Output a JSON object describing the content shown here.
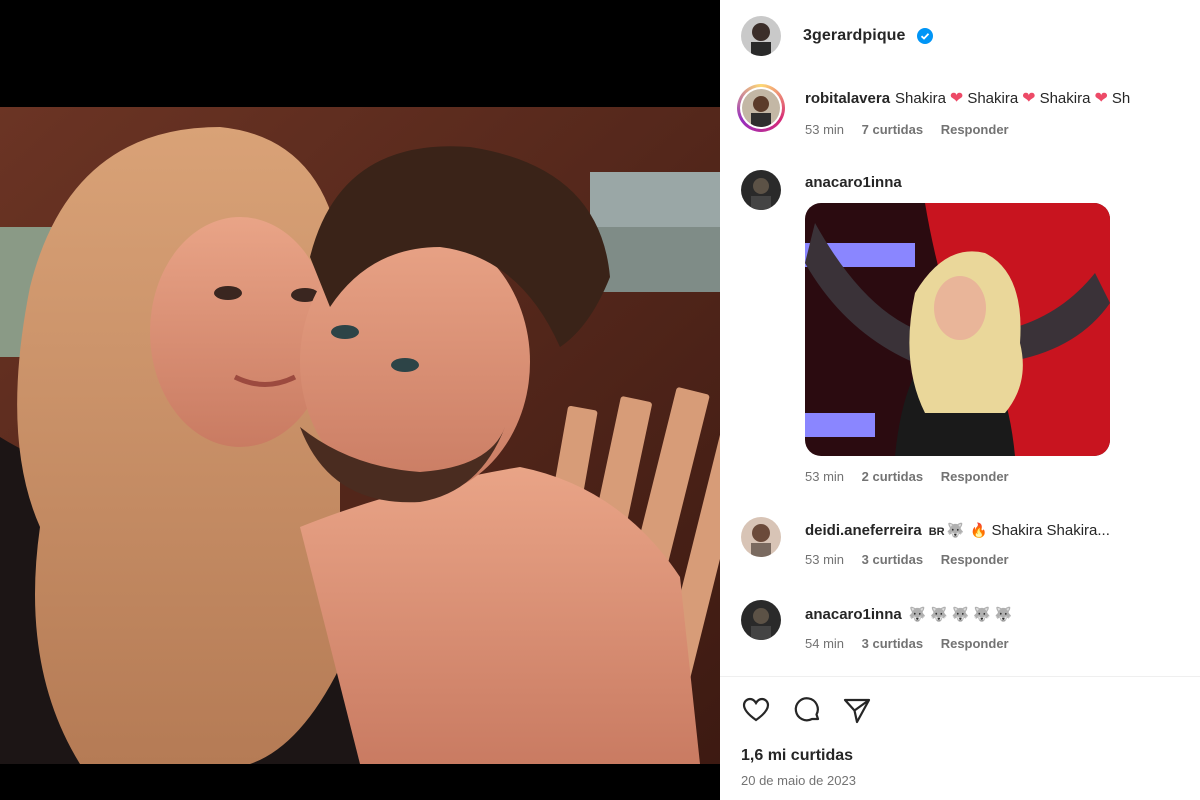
{
  "post": {
    "owner": "3gerardpique",
    "verified": true,
    "likes": "1,6 mi curtidas",
    "date": "20 de maio de 2023"
  },
  "comments": [
    {
      "user": "robitalavera",
      "text": "Shakira",
      "text_repeat": [
        "Shakira",
        "Shakira",
        "Shakira",
        "Sh"
      ],
      "time": "53 min",
      "likes": "7 curtidas",
      "reply": "Responder"
    },
    {
      "user": "anacaro1inna",
      "text": "",
      "has_sticker": true,
      "time": "53 min",
      "likes": "2 curtidas",
      "reply": "Responder"
    },
    {
      "user": "deidi.aneferreira",
      "flag_text": "BR",
      "text": "Shakira Shakira...",
      "time": "53 min",
      "likes": "3 curtidas",
      "reply": "Responder"
    },
    {
      "user": "anacaro1inna",
      "text": "",
      "emoji_count": 5,
      "time": "54 min",
      "likes": "3 curtidas",
      "reply": "Responder"
    }
  ],
  "actions": {
    "like_icon": "heart-outline-icon",
    "comment_icon": "comment-bubble-icon",
    "share_icon": "paper-plane-icon"
  },
  "colors": {
    "verified_blue": "#0095f6",
    "heart_red": "#ed4a67",
    "meta_gray": "#737373",
    "story_ring": [
      "#feda75",
      "#d62976",
      "#962fbf"
    ]
  }
}
